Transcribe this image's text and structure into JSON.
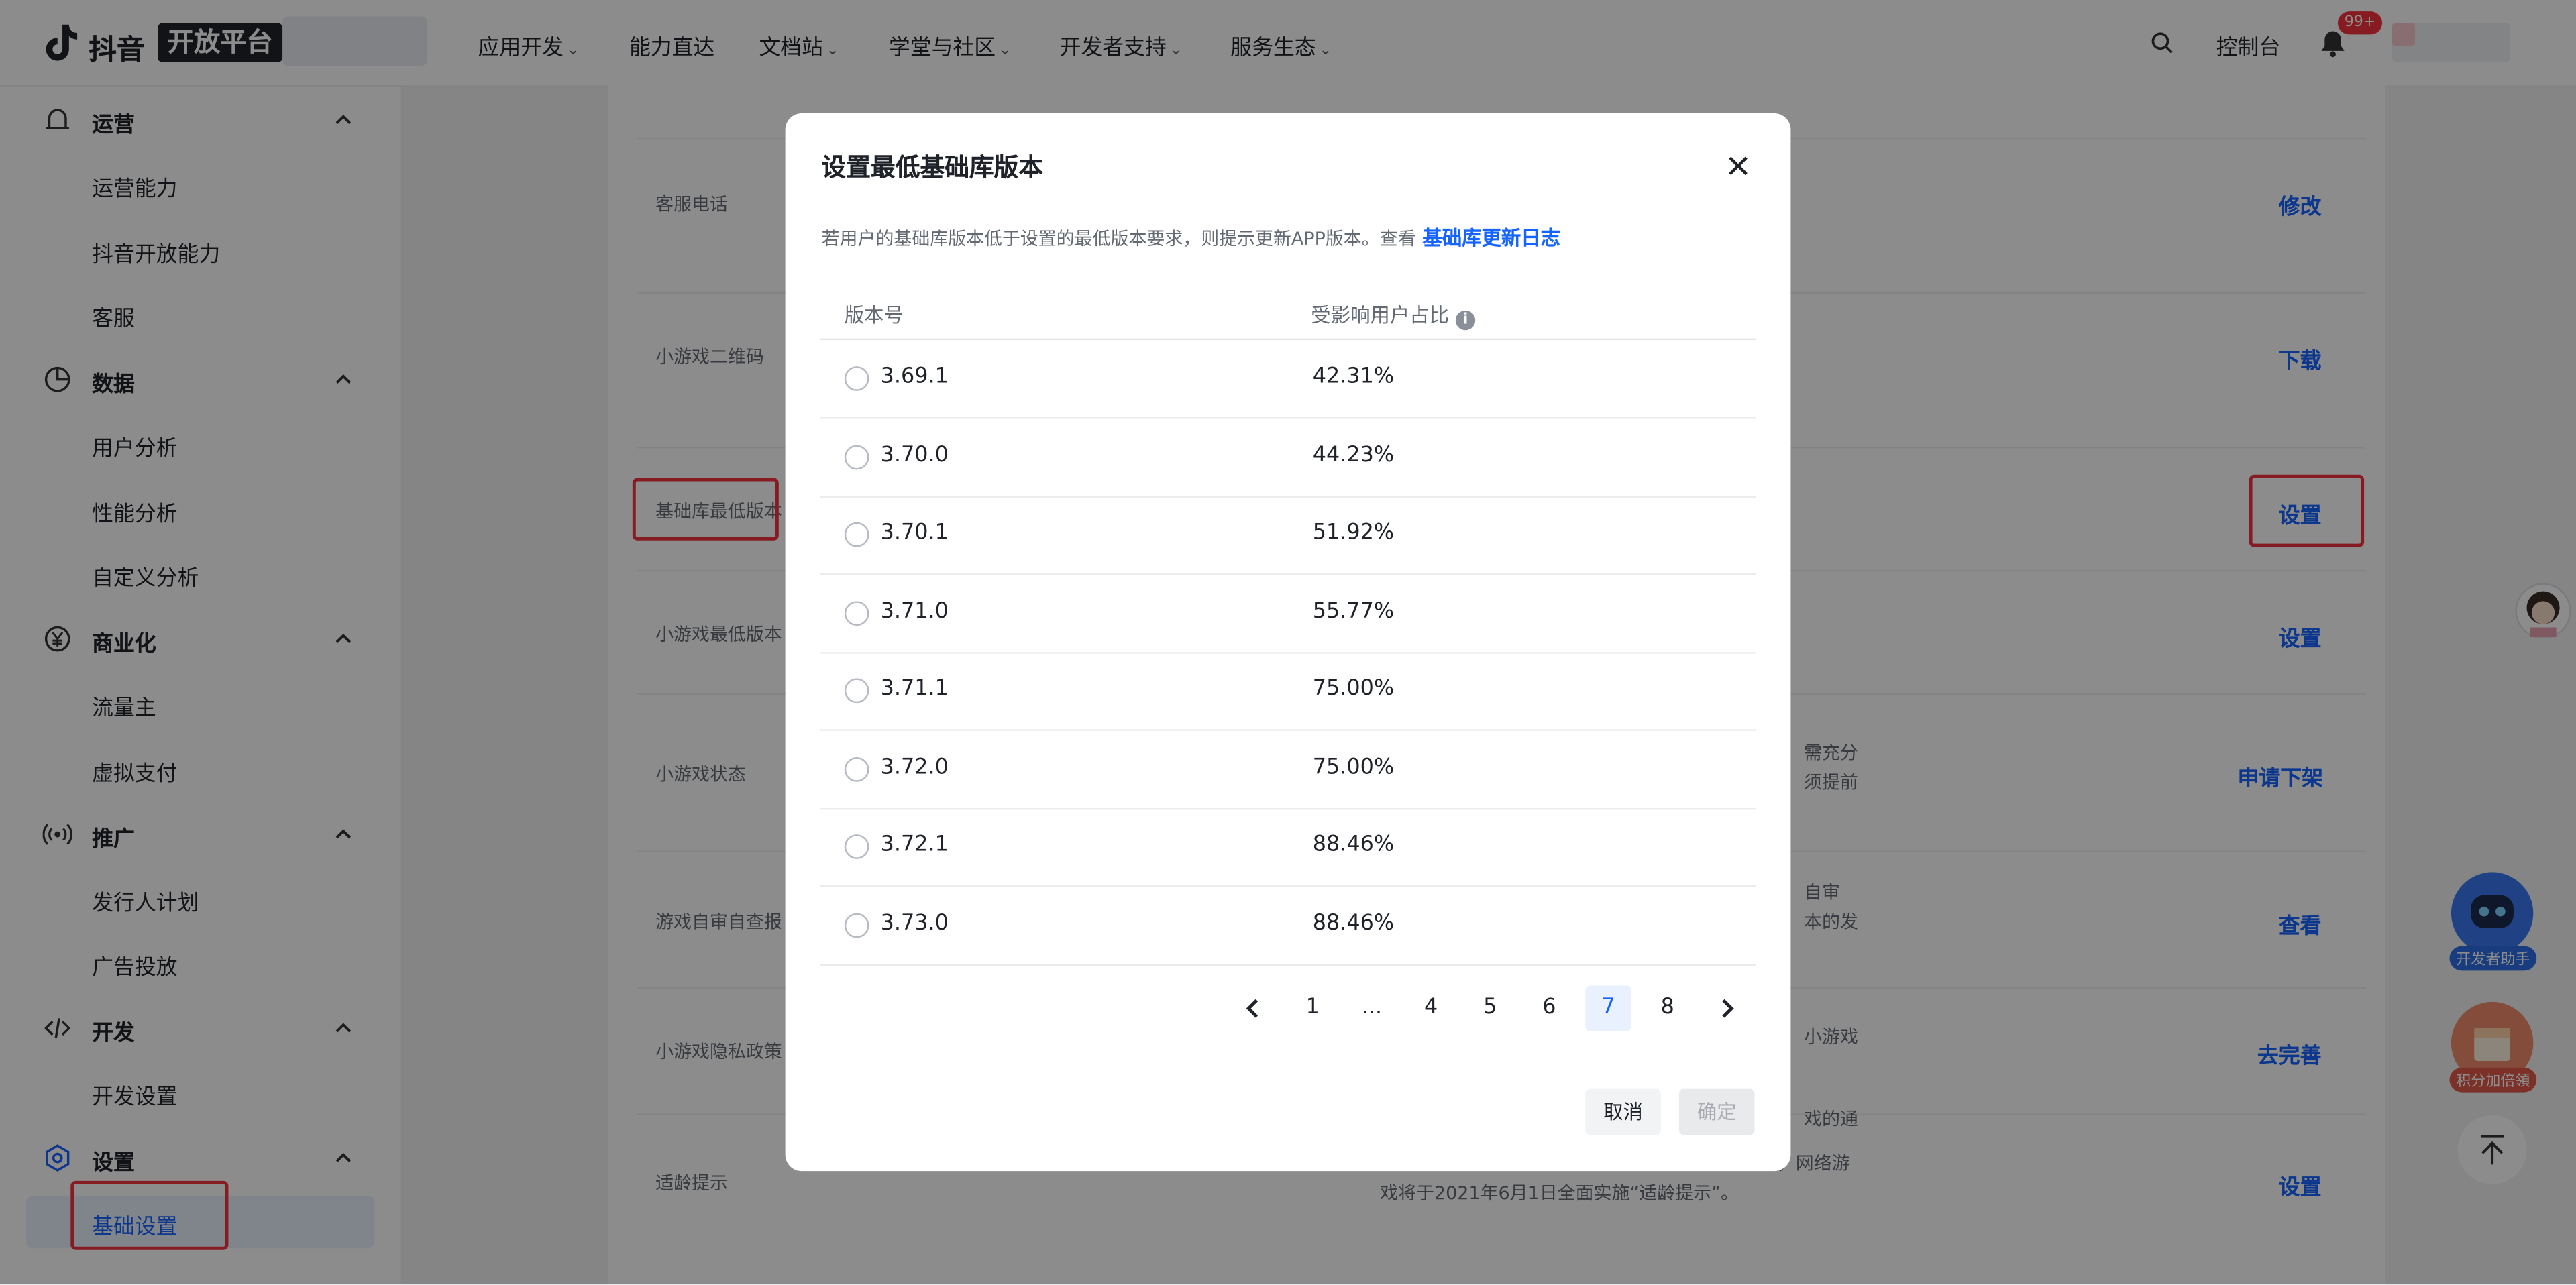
{
  "nav": {
    "brand": "抖音",
    "brand_box": "开放平台",
    "items": [
      "应用开发",
      "能力直达",
      "文档站",
      "学堂与社区",
      "开发者支持",
      "服务生态"
    ],
    "console": "控制台",
    "badge": "99+"
  },
  "sidebar": {
    "sections": [
      {
        "title": "运营",
        "items": [
          "运营能力",
          "抖音开放能力",
          "客服"
        ]
      },
      {
        "title": "数据",
        "items": [
          "用户分析",
          "性能分析",
          "自定义分析"
        ]
      },
      {
        "title": "商业化",
        "items": [
          "流量主",
          "虚拟支付"
        ]
      },
      {
        "title": "推广",
        "items": [
          "发行人计划",
          "广告投放"
        ]
      },
      {
        "title": "开发",
        "items": [
          "开发设置"
        ]
      },
      {
        "title": "设置",
        "items": [
          "基础设置"
        ]
      }
    ]
  },
  "main": {
    "rows": [
      {
        "label": "客服电话",
        "action": "修改"
      },
      {
        "label": "小游戏二维码",
        "action": "下载"
      },
      {
        "label": "基础库最低版本",
        "action": "设置"
      },
      {
        "label": "小游戏最低版本",
        "action": "设置"
      },
      {
        "label": "小游戏状态",
        "action": "申请下架",
        "desc": [
          "需充分",
          "须提前"
        ]
      },
      {
        "label": "游戏自审自查报",
        "action": "查看",
        "desc": [
          "自审",
          "本的发"
        ]
      },
      {
        "label": "小游戏隐私政策",
        "action": "去完善",
        "desc": [
          "小游戏"
        ]
      },
      {
        "label": "适龄提示",
        "action": "设置",
        "desc": [
          "戏的通",
          "知》、《网络游戏适龄提示标识》等法规和标准要求，网络游",
          "戏将于2021年6月1日全面实施“适龄提示”。"
        ]
      }
    ]
  },
  "float": {
    "dev_helper": "开发者助手",
    "points": "积分加倍領"
  },
  "modal": {
    "title": "设置最低基础库版本",
    "desc": "若用户的基础库版本低于设置的最低版本要求，则提示更新APP版本。查看",
    "link": "基础库更新日志",
    "col_version": "版本号",
    "col_ratio": "受影响用户占比",
    "info": "i",
    "rows": [
      {
        "version": "3.69.1",
        "ratio": "42.31%"
      },
      {
        "version": "3.70.0",
        "ratio": "44.23%"
      },
      {
        "version": "3.70.1",
        "ratio": "51.92%"
      },
      {
        "version": "3.71.0",
        "ratio": "55.77%"
      },
      {
        "version": "3.71.1",
        "ratio": "75.00%"
      },
      {
        "version": "3.72.0",
        "ratio": "75.00%"
      },
      {
        "version": "3.72.1",
        "ratio": "88.46%"
      },
      {
        "version": "3.73.0",
        "ratio": "88.46%"
      }
    ],
    "pagination": [
      "1",
      "...",
      "4",
      "5",
      "6",
      "7",
      "8"
    ],
    "current_page": "7",
    "cancel": "取消",
    "confirm": "确定"
  },
  "colors": {
    "accent": "#1664ff",
    "highlight": "#f5333f"
  }
}
